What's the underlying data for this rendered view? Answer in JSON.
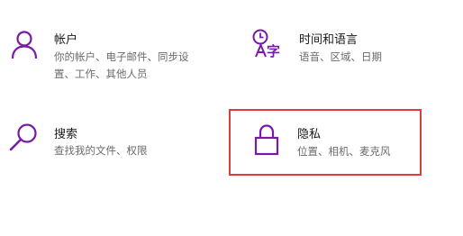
{
  "accent_color": "#7719aa",
  "highlight_border_color": "#d9403b",
  "tiles": {
    "accounts": {
      "icon": "person-icon",
      "title": "帐户",
      "desc_line1": "你的帐户、电子邮件、同步设",
      "desc_line2": "置、工作、其他人员"
    },
    "time_language": {
      "icon": "time-language-icon",
      "title": "时间和语言",
      "desc_line1": "语音、区域、日期"
    },
    "search": {
      "icon": "search-icon",
      "title": "搜索",
      "desc_line1": "查找我的文件、权限"
    },
    "privacy": {
      "icon": "lock-icon",
      "title": "隐私",
      "desc_line1": "位置、相机、麦克风",
      "highlighted": true
    }
  }
}
